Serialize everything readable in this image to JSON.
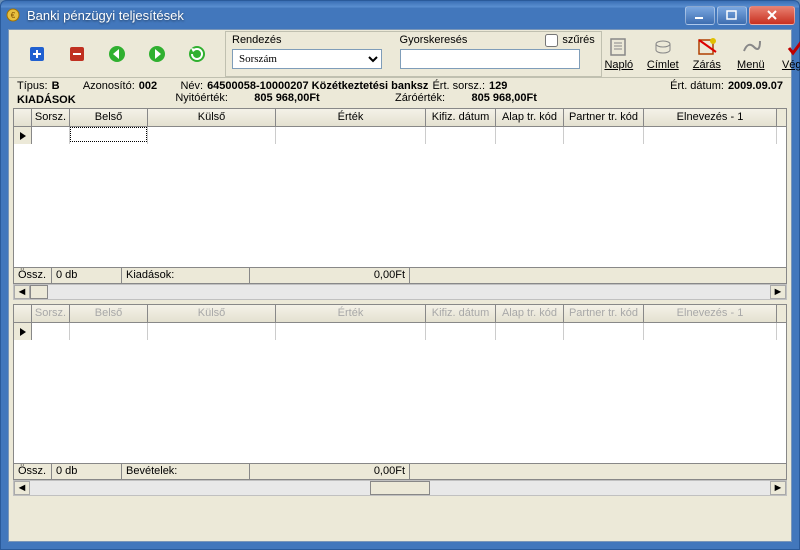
{
  "window": {
    "title": "Banki pénzügyi teljesítések"
  },
  "toolbar": {
    "sort_label": "Rendezés",
    "sort_value": "Sorszám",
    "search_label": "Gyorskeresés",
    "search_value": "",
    "filter_label": "szűrés",
    "right": [
      {
        "label": "Napló"
      },
      {
        "label": "Címlet"
      },
      {
        "label": "Zárás"
      },
      {
        "label": "Menü"
      },
      {
        "label": "Vége"
      }
    ]
  },
  "info": {
    "type_lbl": "Típus:",
    "type_val": "B",
    "id_lbl": "Azonosító:",
    "id_val": "002",
    "name_lbl": "Név:",
    "name_val": "64500058-10000207 Közétkeztetési banksz",
    "ert_lbl": "Ért. sorsz.:",
    "ert_val": "129",
    "date_lbl": "Ért. dátum:",
    "date_val": "2009.09.07",
    "open_lbl": "Nyitóérték:",
    "open_val": "805 968,00Ft",
    "close_lbl": "Záróérték:",
    "close_val": "805 968,00Ft",
    "section": "KIADÁSOK"
  },
  "grid": {
    "columns": [
      "Sorsz.",
      "Belső",
      "Külső",
      "Érték",
      "Kifiz. dátum",
      "Alap tr. kód",
      "Partner tr. kód",
      "Elnevezés - 1"
    ],
    "footer1": {
      "ossz": "Össz.",
      "db": "0 db",
      "label": "Kiadások:",
      "value": "0,00Ft"
    },
    "footer2": {
      "ossz": "Össz.",
      "db": "0 db",
      "label": "Bevételek:",
      "value": "0,00Ft"
    }
  }
}
